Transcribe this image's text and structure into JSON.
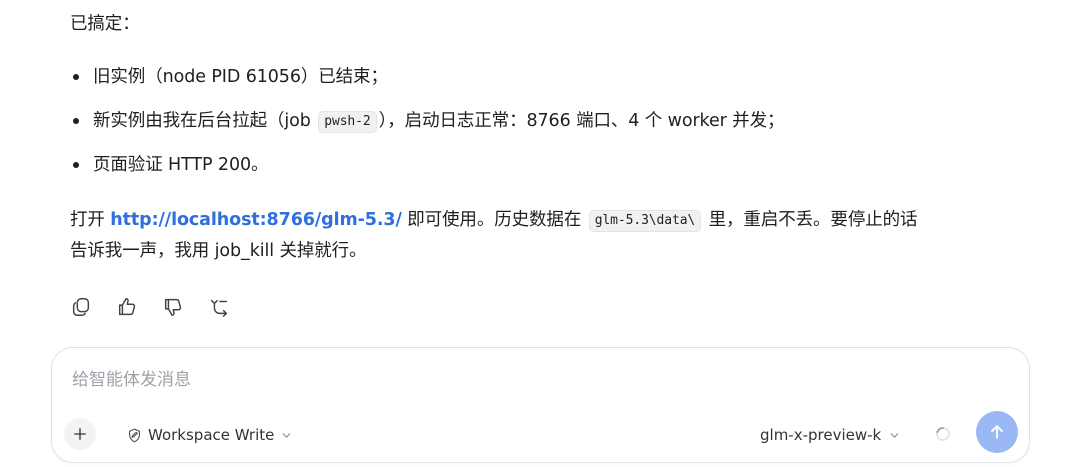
{
  "message": {
    "intro": "已搞定：",
    "bullets": {
      "b1": "旧实例（node PID 61056）已结束；",
      "b2_pre": "新实例由我在后台拉起（job",
      "b2_code": "pwsh-2",
      "b2_post": "），启动日志正常：8766 端口、4 个 worker 并发；",
      "b3": "页面验证 HTTP 200。"
    },
    "para": {
      "pre": "打开",
      "link": "http://localhost:8766/glm-5.3/",
      "mid": "即可使用。历史数据在",
      "code": "glm-5.3\\data\\",
      "post": "里，重启不丢。要停止的话",
      "line2": "告诉我一声，我用 job_kill 关掉就行。"
    }
  },
  "actions": {
    "icons": [
      "copy-icon",
      "thumbs-up-icon",
      "thumbs-down-icon",
      "share-icon"
    ]
  },
  "composer": {
    "placeholder": "给智能体发消息",
    "mode_label": "Workspace Write",
    "model_label": "glm-x-preview-k"
  },
  "colors": {
    "link": "#2f6fe0",
    "send_button": "#9ab8f5",
    "code_bg": "#f1f1f3"
  }
}
